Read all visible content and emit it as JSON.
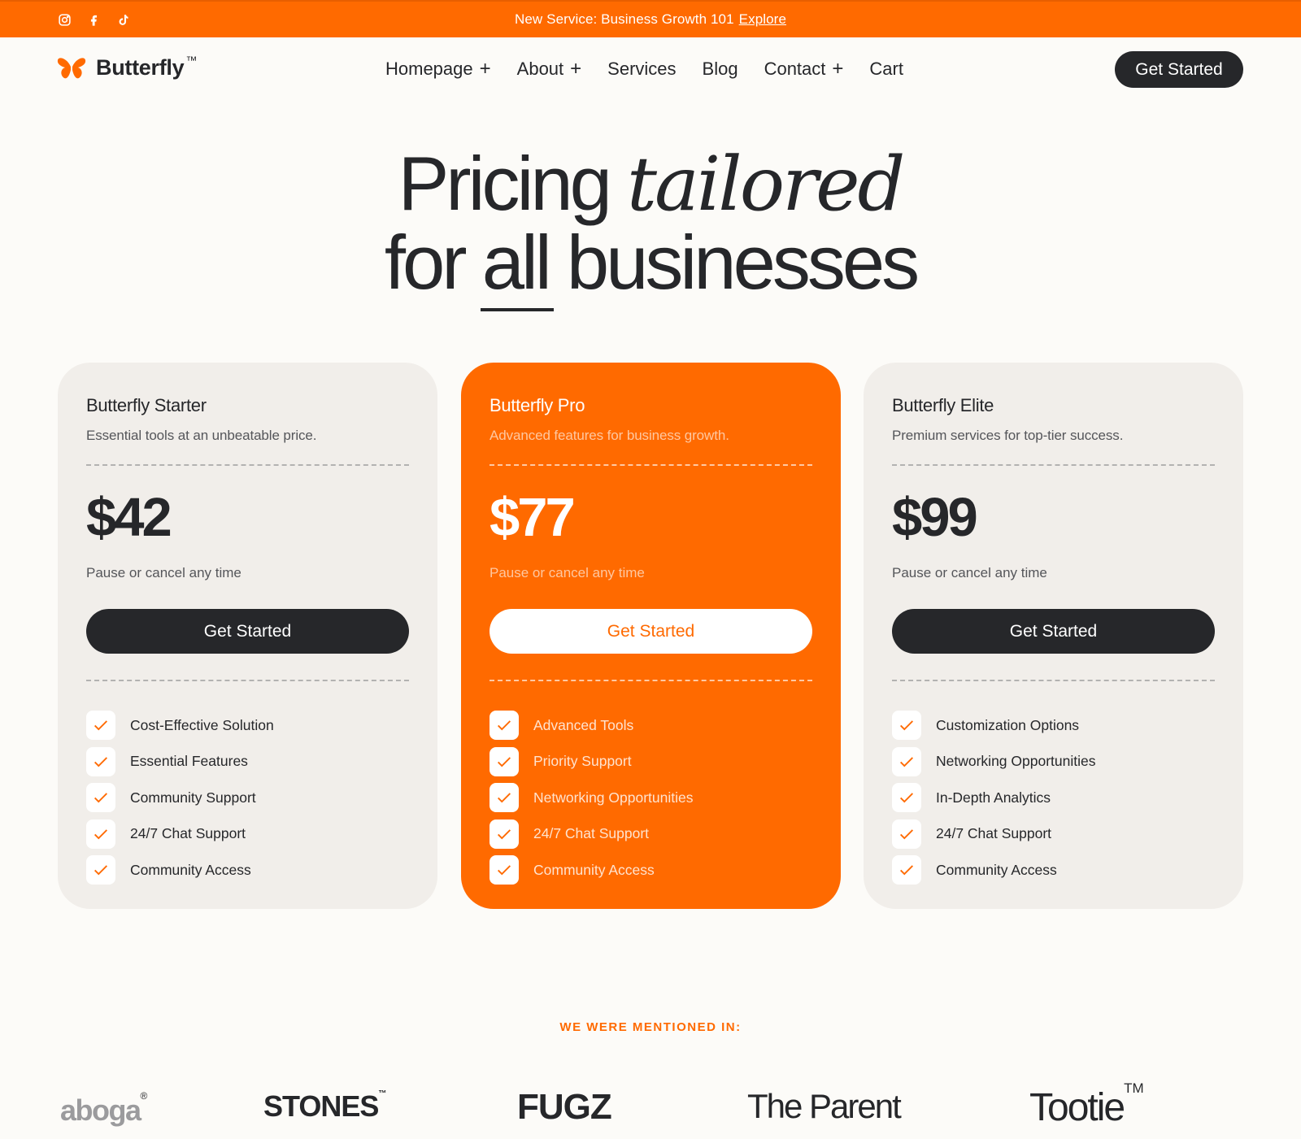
{
  "topbar": {
    "announcement": "New Service: Business Growth 101",
    "link": "Explore",
    "socials": [
      "instagram-icon",
      "facebook-icon",
      "tiktok-icon"
    ]
  },
  "brand": {
    "name": "Butterfly",
    "trademark": "™",
    "accent_color": "#ff6a00",
    "dark_color": "#26272a"
  },
  "nav": {
    "items": [
      {
        "label": "Homepage",
        "has_plus": true
      },
      {
        "label": "About",
        "has_plus": true
      },
      {
        "label": "Services",
        "has_plus": false
      },
      {
        "label": "Blog",
        "has_plus": false
      },
      {
        "label": "Contact",
        "has_plus": true
      },
      {
        "label": "Cart",
        "has_plus": false
      }
    ],
    "plus_symbol": "+",
    "cta": "Get Started"
  },
  "hero": {
    "line1_plain": "Pricing",
    "line1_italic": "tailored",
    "line2_a": "for",
    "line2_underlined": "all",
    "line2_b": "businesses"
  },
  "plans": [
    {
      "name": "Butterfly Starter",
      "description": "Essential tools at an unbeatable price.",
      "price": "$42",
      "note": "Pause or cancel any time",
      "cta": "Get Started",
      "features": [
        "Cost-Effective Solution",
        "Essential Features",
        "Community Support",
        "24/7 Chat Support",
        "Community Access"
      ]
    },
    {
      "name": "Butterfly Pro",
      "description": "Advanced features for business growth.",
      "price": "$77",
      "note": "Pause or cancel any time",
      "cta": "Get Started",
      "features": [
        "Advanced Tools",
        "Priority Support",
        "Networking Opportunities",
        "24/7 Chat Support",
        "Community Access"
      ]
    },
    {
      "name": "Butterfly Elite",
      "description": "Premium services for top-tier success.",
      "price": "$99",
      "note": "Pause or cancel any time",
      "cta": "Get Started",
      "features": [
        "Customization Options",
        "Networking Opportunities",
        "In-Depth Analytics",
        "24/7 Chat Support",
        "Community Access"
      ]
    }
  ],
  "mentions": {
    "title": "WE WERE MENTIONED IN:",
    "logos": [
      {
        "name": "aboga",
        "mark": "®"
      },
      {
        "name": "STONES",
        "mark": "™"
      },
      {
        "name": "FUGZ",
        "mark": ""
      },
      {
        "name": "The Parent",
        "mark": ""
      },
      {
        "name": "Tootie",
        "mark": "TM"
      }
    ]
  }
}
